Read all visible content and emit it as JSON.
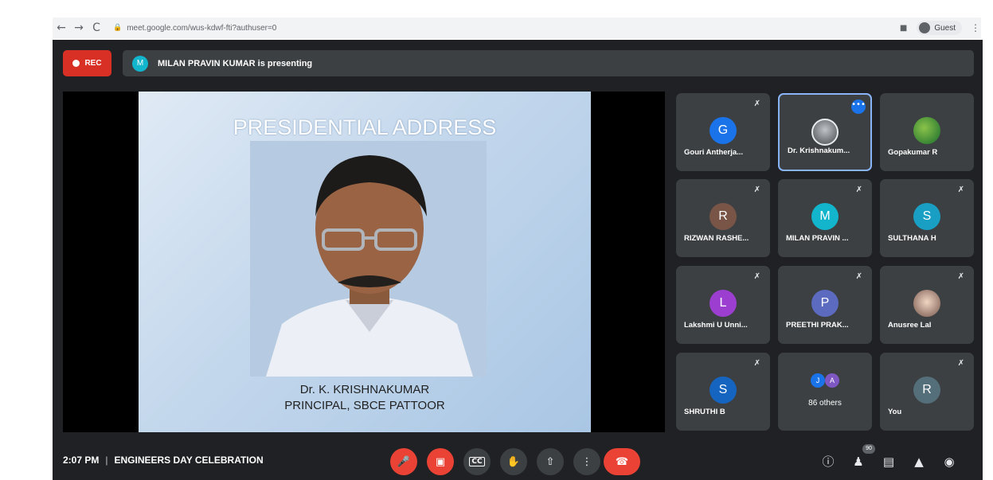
{
  "browser": {
    "url": "meet.google.com/wus-kdwf-fti?authuser=0",
    "profile_label": "Guest",
    "back_icon": "←",
    "forward_icon": "→",
    "reload_icon": "C"
  },
  "meeting": {
    "rec_label": "REC",
    "presenter_initial": "M",
    "presenting_text": "MILAN PRAVIN KUMAR is presenting",
    "time": "2:07 PM",
    "separator": "|",
    "title": "ENGINEERS DAY CELEBRATION",
    "participant_count_badge": "90"
  },
  "slide": {
    "title": "PRESIDENTIAL ADDRESS",
    "name": "Dr. K. KRISHNAKUMAR",
    "role": "PRINCIPAL, SBCE PATTOOR"
  },
  "participants": [
    {
      "name": "Gouri Antherja...",
      "initial": "G",
      "color": "#1a73e8"
    },
    {
      "name": "Dr. Krishnakum...",
      "initial": "",
      "color": ""
    },
    {
      "name": "Gopakumar R",
      "initial": "",
      "color": ""
    },
    {
      "name": "RIZWAN RASHE...",
      "initial": "R",
      "color": "#795548"
    },
    {
      "name": "MILAN PRAVIN ...",
      "initial": "M",
      "color": "#12b5cb"
    },
    {
      "name": "SULTHANA H",
      "initial": "S",
      "color": "#1a9fc4"
    },
    {
      "name": "Lakshmi U Unni...",
      "initial": "L",
      "color": "#9c3fd1"
    },
    {
      "name": "PREETHI PRAK...",
      "initial": "P",
      "color": "#5c6bc0"
    },
    {
      "name": "Anusree Lal",
      "initial": "",
      "color": ""
    },
    {
      "name": "SHRUTHI B",
      "initial": "S",
      "color": "#1565c0"
    },
    {
      "name": "86 others",
      "initial": "",
      "color": ""
    },
    {
      "name": "You",
      "initial": "R",
      "color": "#546e7a"
    }
  ],
  "others_avatars": [
    {
      "initial": "J",
      "color": "#1a73e8"
    },
    {
      "initial": "A",
      "color": "#7e57c2"
    }
  ],
  "colors": {
    "accent": "#1a73e8",
    "danger": "#ea4335",
    "background": "#202124",
    "tile": "#3c4043"
  },
  "icons": {
    "mic_off": "mic-off-icon",
    "camera_off": "camera-off-icon",
    "captions": "captions-icon",
    "raise_hand": "raise-hand-icon",
    "present": "present-icon",
    "more": "more-options-icon",
    "leave": "leave-call-icon",
    "info": "info-icon",
    "people": "people-icon",
    "chat": "chat-icon",
    "activities": "activities-icon",
    "host_controls": "host-controls-icon"
  }
}
